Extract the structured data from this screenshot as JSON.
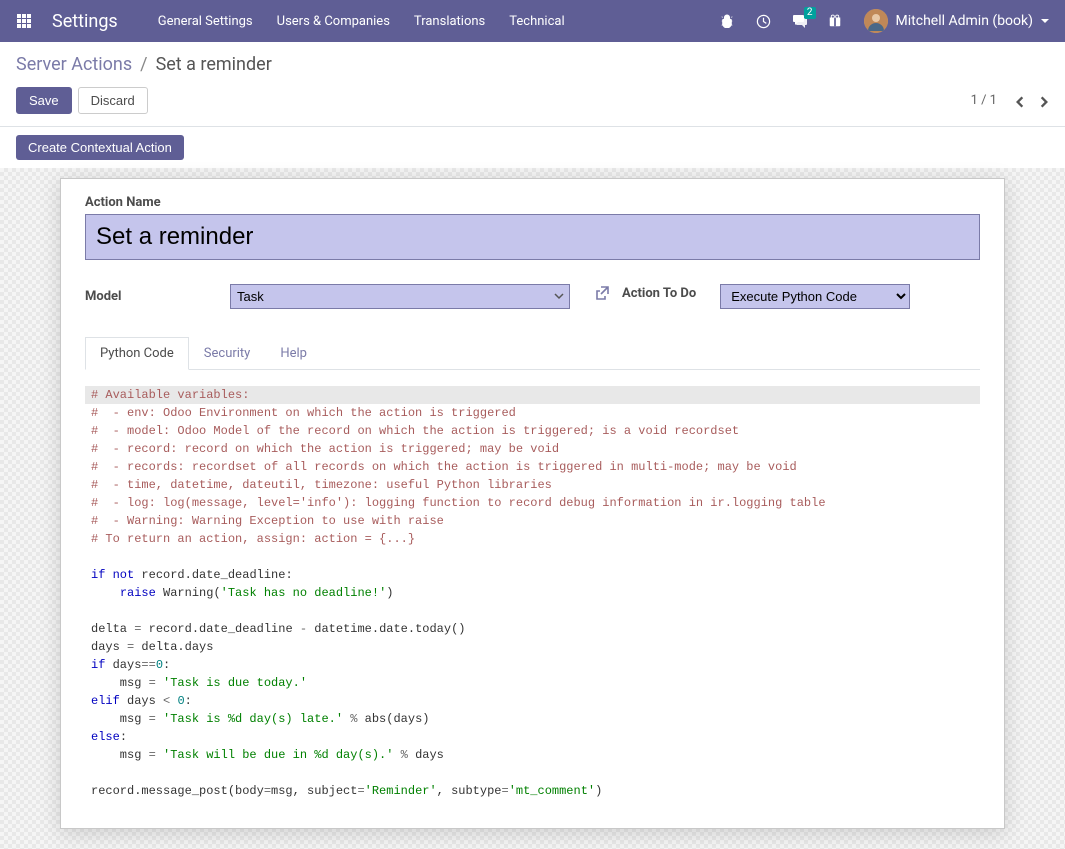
{
  "nav": {
    "app_title": "Settings",
    "menu": [
      "General Settings",
      "Users & Companies",
      "Translations",
      "Technical"
    ],
    "chat_badge": "2",
    "user_name": "Mitchell Admin (book)"
  },
  "breadcrumb": {
    "parent": "Server Actions",
    "current": "Set a reminder"
  },
  "buttons": {
    "save": "Save",
    "discard": "Discard",
    "create_contextual": "Create Contextual Action"
  },
  "pager": {
    "text": "1 / 1"
  },
  "form": {
    "action_name_label": "Action Name",
    "action_name_value": "Set a reminder",
    "model_label": "Model",
    "model_value": "Task",
    "action_todo_label": "Action To Do",
    "action_todo_value": "Execute Python Code"
  },
  "tabs": {
    "items": [
      "Python Code",
      "Security",
      "Help"
    ],
    "active_index": 0
  },
  "code": {
    "c0": "# Available variables:",
    "c1": "#  - env: Odoo Environment on which the action is triggered",
    "c2": "#  - model: Odoo Model of the record on which the action is triggered; is a void recordset",
    "c3": "#  - record: record on which the action is triggered; may be void",
    "c4": "#  - records: recordset of all records on which the action is triggered in multi-mode; may be void",
    "c5": "#  - time, datetime, dateutil, timezone: useful Python libraries",
    "c6": "#  - log: log(message, level='info'): logging function to record debug information in ir.logging table",
    "c7": "#  - Warning: Warning Exception to use with raise",
    "c8": "# To return an action, assign: action = {...}",
    "k_if": "if",
    "k_not": "not",
    "k_raise": "raise",
    "k_elif": "elif",
    "k_else": "else",
    "t_rec_deadline": " record.date_deadline",
    "t_warning": " Warning(",
    "s_no_deadline": "'Task has no deadline!'",
    "t_close_paren": ")",
    "t_delta_assign": "delta ",
    "t_eq": "=",
    "t_delta_expr": " record.date_deadline ",
    "t_minus": "-",
    "t_date_today": " datetime.date.today()",
    "t_days_assign": "days ",
    "t_delta_days": " delta.days",
    "t_days": " days",
    "t_eqeq": "==",
    "n_zero": "0",
    "t_msg_assign": "    msg ",
    "s_due_today": "'Task is due today.'",
    "t_lt": "<",
    "s_days_late": "'Task is %d day(s) late.'",
    "t_pct": " % ",
    "t_abs_days": "abs(days)",
    "s_will_be_due": "'Task will be due in %d day(s).'",
    "t_days_plain": "days",
    "t_msg_post": "record.message_post(body",
    "t_msg": "msg, subject",
    "s_reminder": "'Reminder'",
    "t_subtype": ", subtype",
    "s_mt_comment": "'mt_comment'",
    "t_colon": ":",
    "t_space": " "
  }
}
